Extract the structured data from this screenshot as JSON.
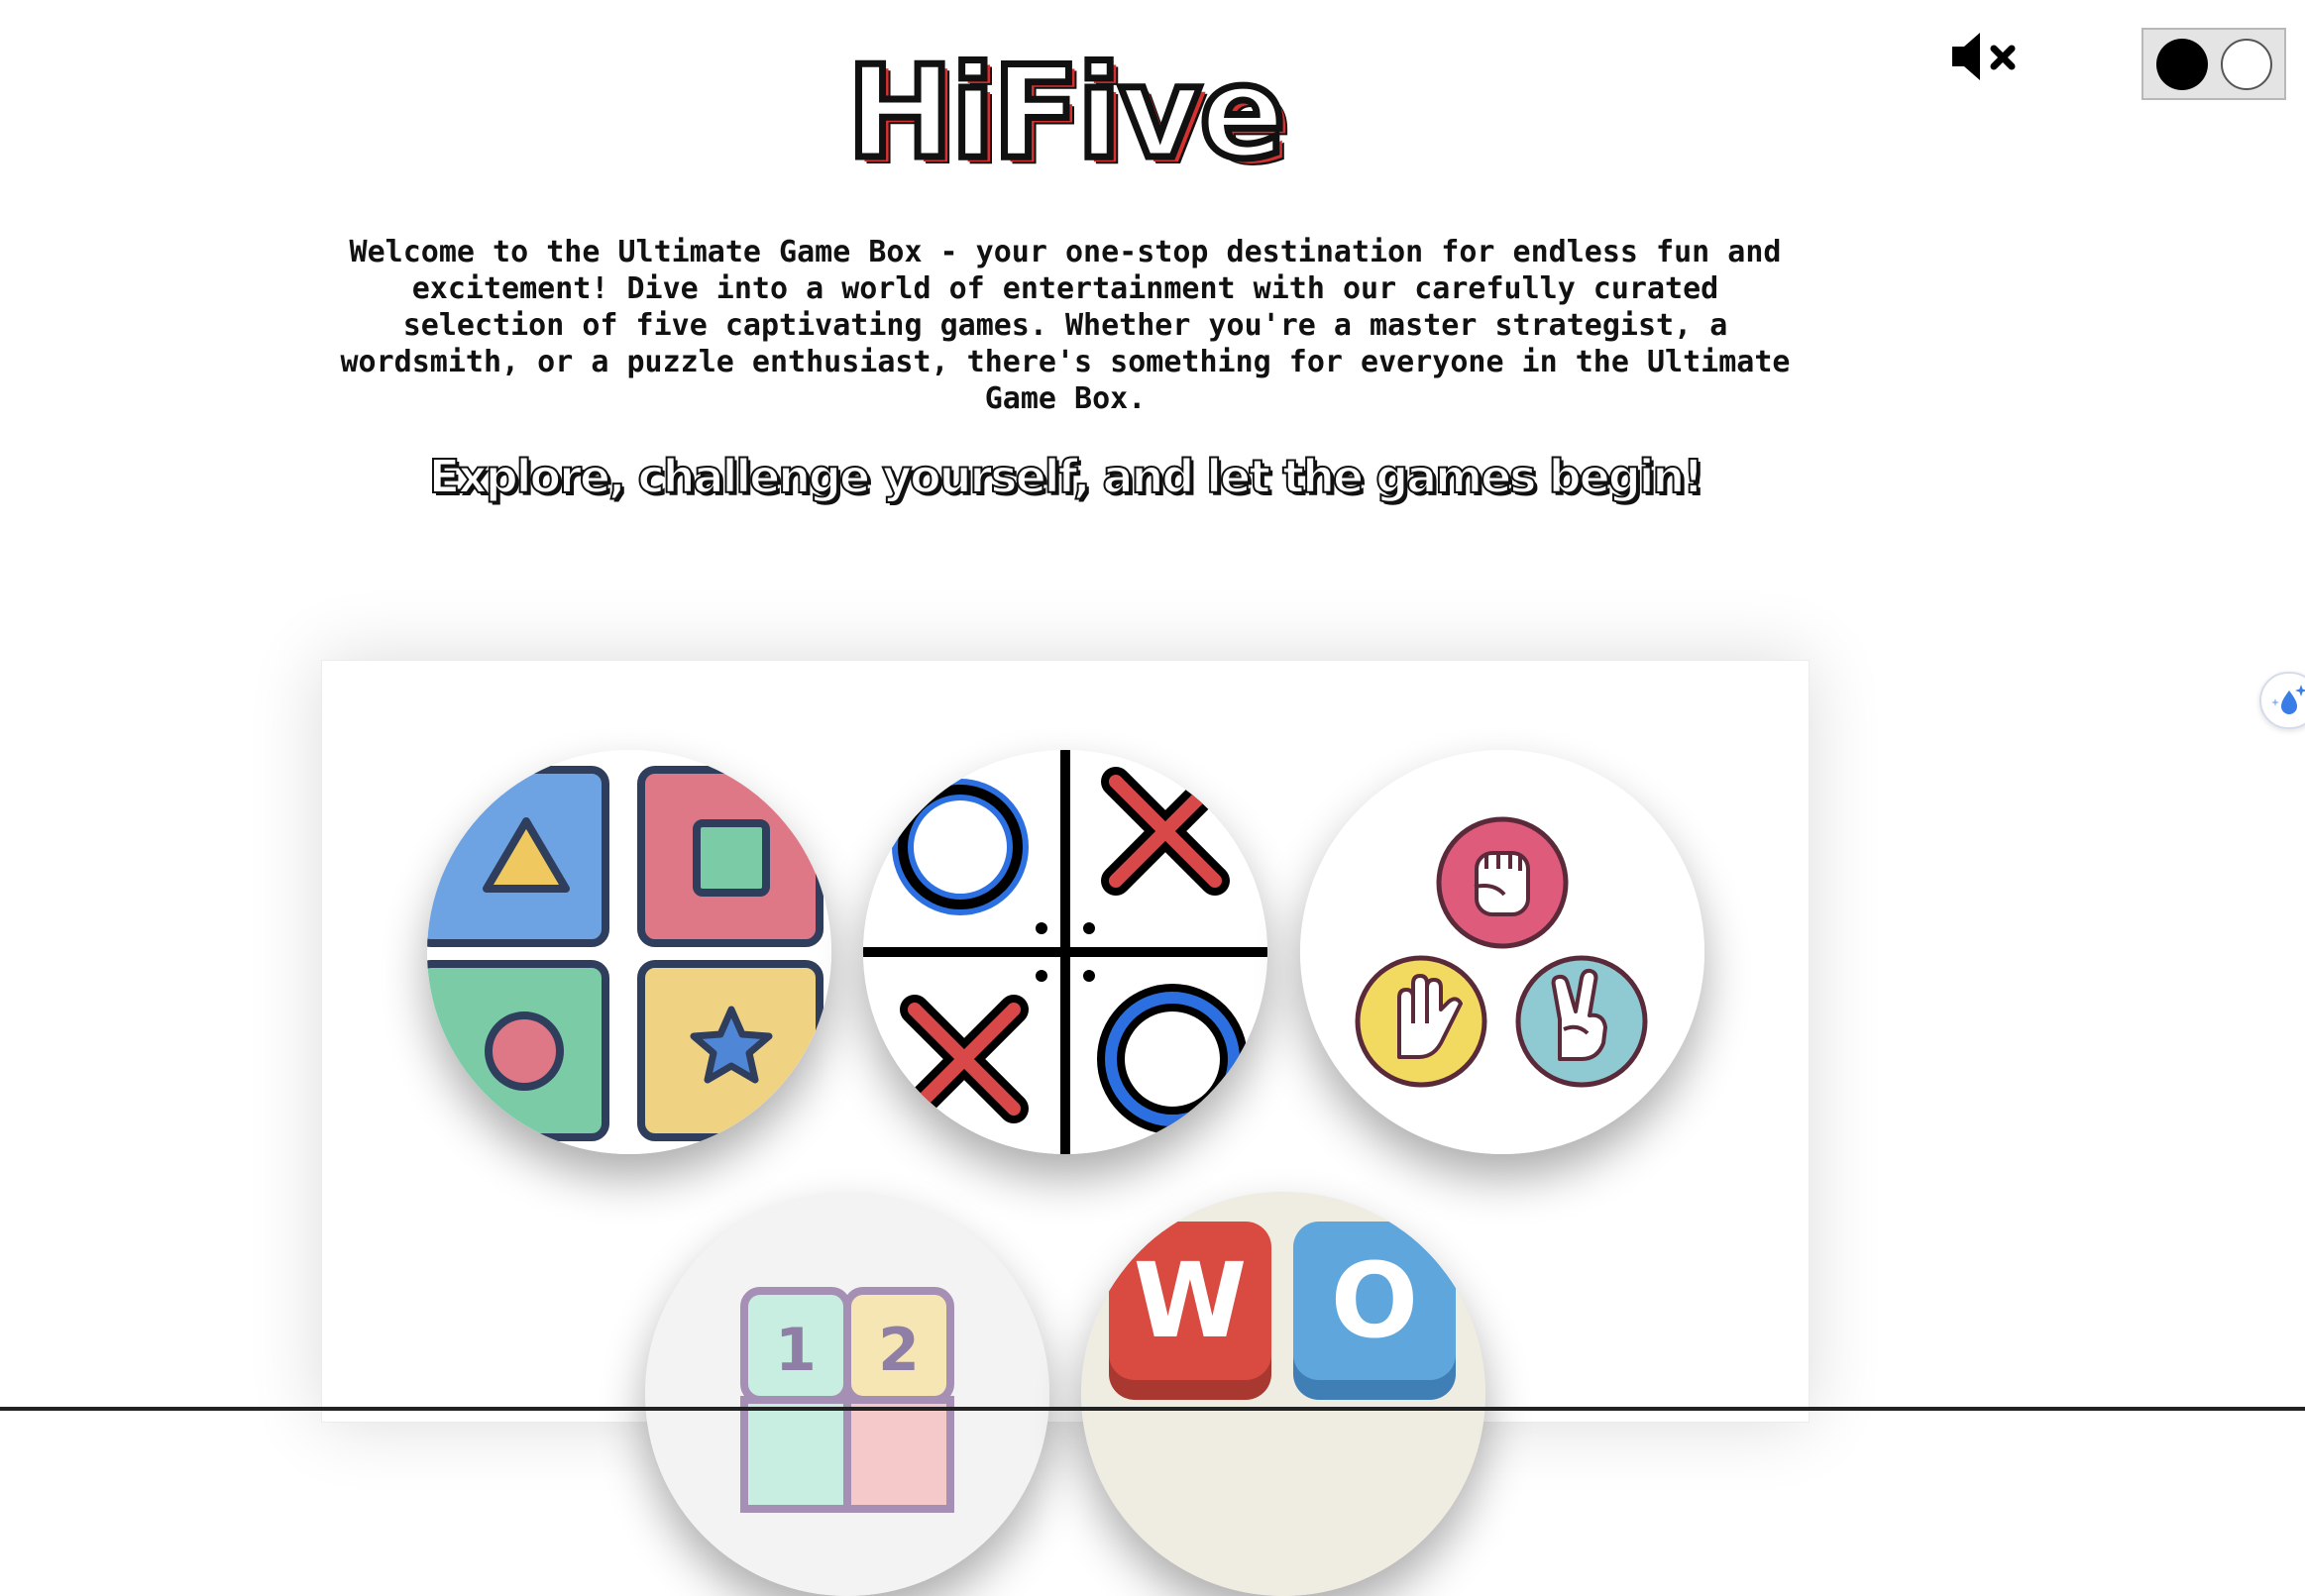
{
  "header": {
    "logo_text": "HiFive",
    "mute_icon": "speaker-muted-icon",
    "theme_options": [
      "dark",
      "light"
    ]
  },
  "intro": {
    "text": "Welcome to the Ultimate Game Box - your one-stop destination for endless fun and excitement! Dive into a world of entertainment with our carefully curated selection of five captivating games. Whether you're a master strategist, a wordsmith, or a puzzle enthusiast, there's something for everyone in the Ultimate Game Box."
  },
  "tagline": "Explore, challenge yourself, and let the games begin!",
  "games": {
    "memory": {
      "icon": "shape-memory-grid-icon"
    },
    "tictactoe": {
      "icon": "tic-tac-toe-icon"
    },
    "rps": {
      "icon": "rock-paper-scissors-icon"
    },
    "sudoku": {
      "icon": "number-grid-icon",
      "digits": [
        "1",
        "2"
      ]
    },
    "word": {
      "icon": "letter-tiles-icon",
      "letters": [
        "W",
        "O"
      ]
    }
  },
  "side_widget": {
    "icon": "sparkle-drop-icon"
  },
  "colors": {
    "blue": "#6ea3e3",
    "pink": "#de7886",
    "green": "#7acba6",
    "yellow": "#f0d283",
    "red": "#d94848",
    "ring_blue": "#2b6fe0",
    "tile_red": "#d94a40",
    "tile_blue": "#5fa6dd"
  }
}
